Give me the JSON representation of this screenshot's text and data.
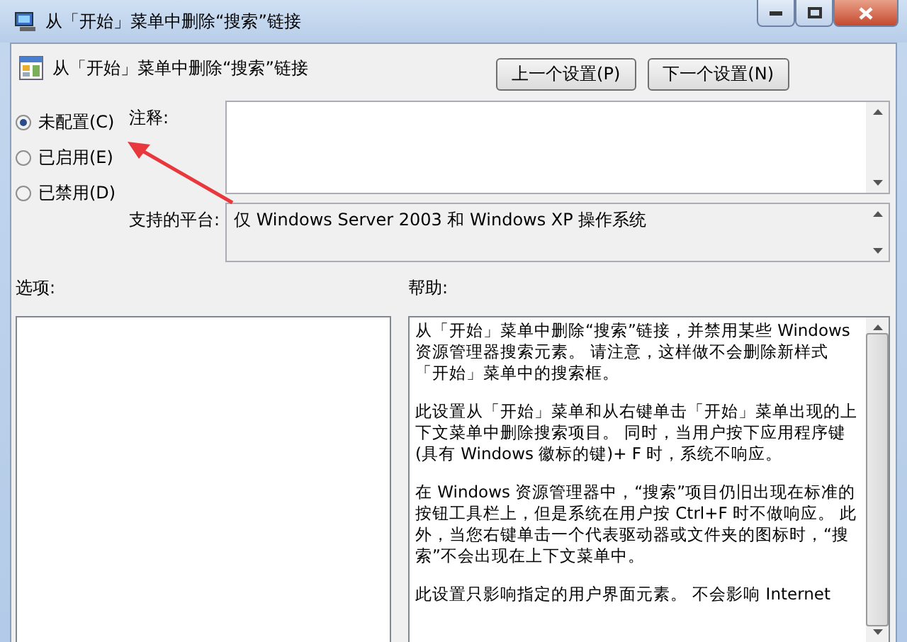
{
  "window": {
    "title": "从「开始」菜单中删除“搜索”链接"
  },
  "policy_title": "从「开始」菜单中删除“搜索”链接",
  "buttons": [
    "上一个设置(P)",
    "下一个设置(N)"
  ],
  "states": [
    {
      "label": "未配置(C)",
      "selected": true
    },
    {
      "label": "已启用(E)",
      "selected": false
    },
    {
      "label": "已禁用(D)",
      "selected": false
    }
  ],
  "comment": {
    "label": "注释:"
  },
  "platform": {
    "label": "支持的平台:",
    "value": "仅 Windows Server 2003 和 Windows XP 操作系统"
  },
  "options": {
    "label": "选项:"
  },
  "help": {
    "label": "帮助:",
    "paragraphs": [
      "从「开始」菜单中删除“搜索”链接，并禁用某些 Windows 资源管理器搜索元素。 请注意，这样做不会删除新样式「开始」菜单中的搜索框。",
      "此设置从「开始」菜单和从右键单击「开始」菜单出现的上下文菜单中删除搜索项目。 同时，当用户按下应用程序键(具有 Windows 徽标的键)+ F 时，系统不响应。",
      "在 Windows 资源管理器中，“搜索”项目仍旧出现在标准的按钮工具栏上，但是系统在用户按 Ctrl+F 时不做响应。 此外，当您右键单击一个代表驱动器或文件夹的图标时，“搜索”不会出现在上下文菜单中。",
      "此设置只影响指定的用户界面元素。 不会影响 Internet"
    ]
  }
}
